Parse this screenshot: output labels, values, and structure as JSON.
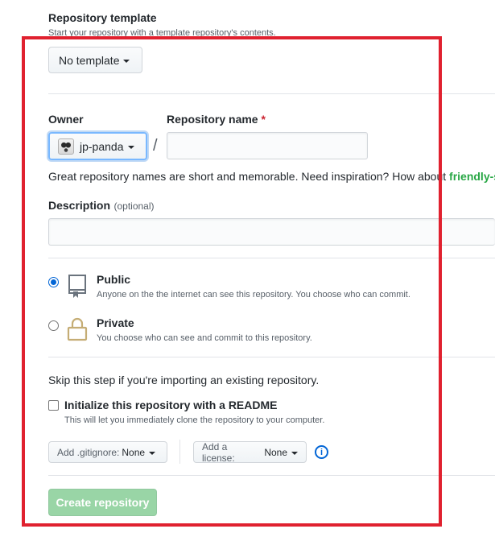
{
  "template": {
    "heading": "Repository template",
    "note": "Start your repository with a template repository's contents.",
    "button_label": "No template"
  },
  "owner": {
    "label": "Owner",
    "selected": "jp-panda",
    "separator": "/"
  },
  "repo_name": {
    "label": "Repository name",
    "required_mark": "*",
    "value": ""
  },
  "hint": {
    "text": "Great repository names are short and memorable. Need inspiration? How about",
    "suggestion": "friendly-s"
  },
  "description": {
    "label": "Description",
    "optional": "(optional)",
    "value": ""
  },
  "visibility": {
    "public": {
      "title": "Public",
      "description": "Anyone on the the internet can see this repository. You choose who can commit."
    },
    "private": {
      "title": "Private",
      "description": "You choose who can see and commit to this repository."
    }
  },
  "init": {
    "skip_note": "Skip this step if you're importing an existing repository.",
    "readme_label": "Initialize this repository with a README",
    "readme_note": "This will let you immediately clone the repository to your computer."
  },
  "gitignore": {
    "prefix": "Add .gitignore:",
    "value": "None"
  },
  "license": {
    "prefix": "Add a license:",
    "value": "None"
  },
  "info_icon": "i",
  "submit_label": "Create repository",
  "colors": {
    "accent": "#0366d6",
    "submit_disabled": "#94d3a2",
    "highlight": "#e0212f",
    "suggestion": "#28a745"
  }
}
